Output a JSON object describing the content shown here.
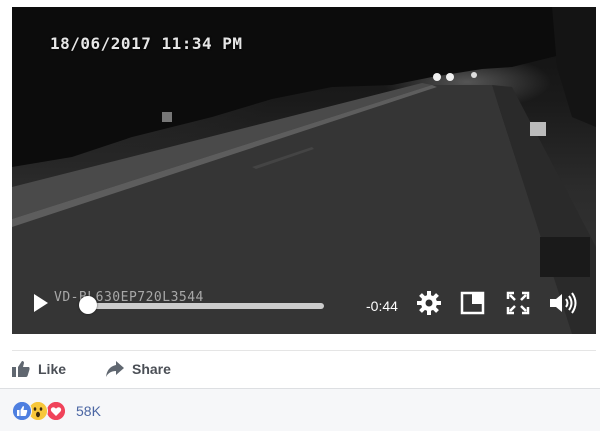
{
  "video": {
    "overlay_timestamp": "18/06/2017  11:34 PM",
    "overlay_camera_id": "VD-BL630EP720L3544",
    "controls": {
      "play_icon": "play-icon",
      "progress": 0.0,
      "time_remaining": "-0:44",
      "settings_icon": "gear-icon",
      "pip_icon": "picture-in-picture-icon",
      "fullscreen_icon": "fullscreen-icon",
      "volume_icon": "volume-icon"
    }
  },
  "actions": {
    "like_label": "Like",
    "share_label": "Share"
  },
  "reactions": {
    "icons": [
      "like-reaction-icon",
      "wow-reaction-icon",
      "love-reaction-icon"
    ],
    "count": "58K"
  },
  "colors": {
    "action_text": "#4b4f56",
    "reaction_count": "#4b66a3",
    "like_blue": "#4e7fe0",
    "wow_yellow": "#f7c73b",
    "love_red": "#f0435a"
  }
}
